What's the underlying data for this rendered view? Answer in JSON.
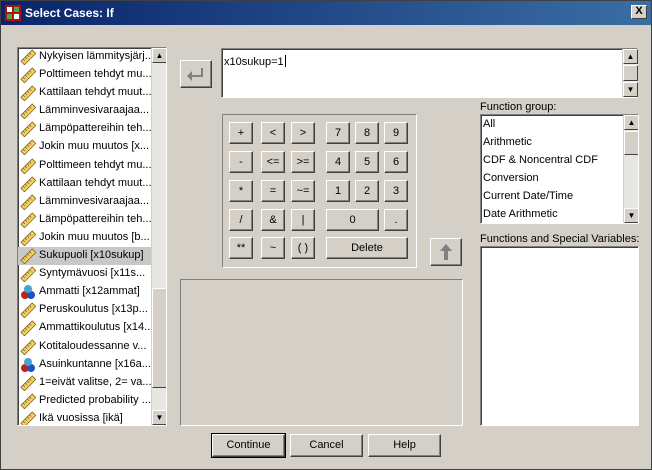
{
  "window": {
    "title": "Select Cases: If",
    "close_glyph": "X"
  },
  "variables": {
    "items": [
      {
        "label": "Nykyisen lämmitysjärj...",
        "icon": "ruler-icon"
      },
      {
        "label": "Polttimeen tehdyt mu...",
        "icon": "ruler-icon"
      },
      {
        "label": "Kattilaan tehdyt muut...",
        "icon": "ruler-icon"
      },
      {
        "label": "Lämminvesivaraajaa...",
        "icon": "ruler-icon"
      },
      {
        "label": "Lämpöpattereihin teh...",
        "icon": "ruler-icon"
      },
      {
        "label": "Jokin muu muutos [x...",
        "icon": "ruler-icon"
      },
      {
        "label": "Polttimeen tehdyt mu...",
        "icon": "ruler-icon"
      },
      {
        "label": "Kattilaan tehdyt muut...",
        "icon": "ruler-icon"
      },
      {
        "label": "Lämminvesivaraajaa...",
        "icon": "ruler-icon"
      },
      {
        "label": "Lämpöpattereihin teh...",
        "icon": "ruler-icon"
      },
      {
        "label": "Jokin muu muutos [b...",
        "icon": "ruler-icon"
      },
      {
        "label": "Sukupuoli [x10sukup]",
        "icon": "ruler-icon",
        "selected": true
      },
      {
        "label": "Syntymävuosi [x11s...",
        "icon": "ruler-icon"
      },
      {
        "label": "Ammatti [x12ammat]",
        "icon": "nominal-icon"
      },
      {
        "label": "Peruskoulutus [x13p...",
        "icon": "ruler-icon"
      },
      {
        "label": "Ammattikoulutus [x14...",
        "icon": "ruler-icon"
      },
      {
        "label": "Kotitaloudessanne v...",
        "icon": "ruler-icon"
      },
      {
        "label": "Asuinkuntanne [x16a...",
        "icon": "nominal-icon"
      },
      {
        "label": "1=eivät valitse, 2= va...",
        "icon": "ruler-icon"
      },
      {
        "label": "Predicted probability ...",
        "icon": "ruler-icon"
      },
      {
        "label": "Ikä vuosissa [ikä]",
        "icon": "ruler-icon"
      }
    ]
  },
  "expression": {
    "value": "x10sukup=1"
  },
  "keypad": {
    "keys": [
      "+",
      "<",
      ">",
      "7",
      "8",
      "9",
      "-",
      "<=",
      ">=",
      "4",
      "5",
      "6",
      "*",
      "=",
      "~=",
      "1",
      "2",
      "3",
      "/",
      "&",
      "|",
      "0",
      ".",
      "**",
      "~",
      "( )",
      "Delete"
    ]
  },
  "function_group": {
    "label": "Function group:",
    "items": [
      "All",
      "Arithmetic",
      "CDF & Noncentral CDF",
      "Conversion",
      "Current Date/Time",
      "Date Arithmetic"
    ]
  },
  "functions": {
    "label": "Functions and Special Variables:"
  },
  "buttons": {
    "continue": "Continue",
    "cancel": "Cancel",
    "help": "Help"
  },
  "colors": {
    "title_start": "#0a246a",
    "title_end": "#3a6ea5",
    "face": "#d4d0c8",
    "selected_row": "#c8c8c8"
  }
}
